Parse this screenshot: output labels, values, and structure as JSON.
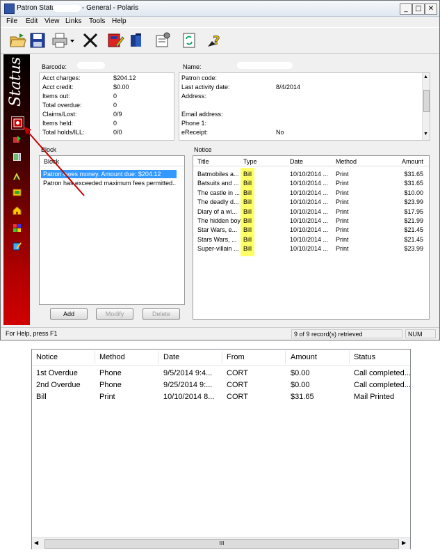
{
  "window": {
    "title_prefix": "Patron Status",
    "title_suffix": "- General - Polaris",
    "controls": [
      "_",
      "□",
      "✕"
    ]
  },
  "menu": [
    "File",
    "Edit",
    "View",
    "Links",
    "Tools",
    "Help"
  ],
  "toolbar_icons": [
    "open-folder-icon",
    "save-icon",
    "print-icon",
    "print-dropdown-icon",
    "delete-icon",
    "edit-record-icon",
    "books-icon",
    "properties-icon",
    "refresh-icon",
    "help-icon"
  ],
  "sidebar": {
    "label": "Status",
    "icons": [
      "status-icon",
      "check-in-icon",
      "barcode-items-icon",
      "claims-icon",
      "holds-icon",
      "home-icon",
      "fines-icon",
      "notes-icon"
    ]
  },
  "patron": {
    "barcode_label": "Barcode:",
    "name_label": "Name:",
    "left_rows": [
      {
        "label": "Acct charges:",
        "value": "$204.12"
      },
      {
        "label": "Acct credit:",
        "value": "$0.00"
      },
      {
        "label": "Items out:",
        "value": "0"
      },
      {
        "label": "Total overdue:",
        "value": "0"
      },
      {
        "label": "Claims/Lost:",
        "value": "0/9"
      },
      {
        "label": "Items held:",
        "value": "0"
      },
      {
        "label": "Total holds/ILL:",
        "value": "0/0"
      }
    ],
    "right_rows": [
      {
        "label": "Patron code:",
        "value": ""
      },
      {
        "label": "Last activity date:",
        "value": "8/4/2014"
      },
      {
        "label": "Address:",
        "value": ""
      },
      {
        "label": "",
        "value": "_"
      },
      {
        "label": "Email address:",
        "value": ""
      },
      {
        "label": "Phone 1:",
        "value": ""
      },
      {
        "label": "eReceipt:",
        "value": "No"
      }
    ]
  },
  "block": {
    "title": "Block",
    "header": "Block",
    "items": [
      "Patron owes money. Amount due: $204.12",
      "Patron has exceeded maximum fees permitted..."
    ],
    "buttons": {
      "add": "Add",
      "modify": "Modify",
      "delete": "Delete"
    }
  },
  "notice": {
    "title": "Notice",
    "columns": [
      "Title",
      "Type",
      "Date",
      "Method",
      "Amount"
    ],
    "rows": [
      {
        "title": "Batmobiles a...",
        "type": "Bill",
        "date": "10/10/2014 ...",
        "method": "Print",
        "amount": "$31.65"
      },
      {
        "title": "Batsuits and ...",
        "type": "Bill",
        "date": "10/10/2014 ...",
        "method": "Print",
        "amount": "$31.65"
      },
      {
        "title": "The castle in ...",
        "type": "Bill",
        "date": "10/10/2014 ...",
        "method": "Print",
        "amount": "$10.00"
      },
      {
        "title": "The deadly d...",
        "type": "Bill",
        "date": "10/10/2014 ...",
        "method": "Print",
        "amount": "$23.99"
      },
      {
        "title": "Diary of a wi...",
        "type": "Bill",
        "date": "10/10/2014 ...",
        "method": "Print",
        "amount": "$17.95"
      },
      {
        "title": "The hidden boy",
        "type": "Bill",
        "date": "10/10/2014 ...",
        "method": "Print",
        "amount": "$21.99"
      },
      {
        "title": "Star Wars, e...",
        "type": "Bill",
        "date": "10/10/2014 ...",
        "method": "Print",
        "amount": "$21.45"
      },
      {
        "title": "Stars Wars, ...",
        "type": "Bill",
        "date": "10/10/2014 ...",
        "method": "Print",
        "amount": "$21.45"
      },
      {
        "title": "Super-villain ...",
        "type": "Bill",
        "date": "10/10/2014 ...",
        "method": "Print",
        "amount": "$23.99"
      }
    ]
  },
  "statusbar": {
    "help": "For Help, press F1",
    "records": "9 of 9 record(s) retrieved",
    "num": "NUM"
  },
  "detail_list": {
    "columns": [
      "Notice",
      "Method",
      "Date",
      "From",
      "Amount",
      "Status"
    ],
    "rows": [
      {
        "notice": "1st Overdue",
        "method": "Phone",
        "date": "9/5/2014 9:4...",
        "from": "CORT",
        "amount": "$0.00",
        "status": "Call completed..."
      },
      {
        "notice": "2nd Overdue",
        "method": "Phone",
        "date": "9/25/2014 9:...",
        "from": "CORT",
        "amount": "$0.00",
        "status": "Call completed..."
      },
      {
        "notice": "Bill",
        "method": "Print",
        "date": "10/10/2014 8...",
        "from": "CORT",
        "amount": "$31.65",
        "status": "Mail Printed"
      }
    ],
    "scroll_grip": "III"
  },
  "colors": {
    "accent_red": "#c00000",
    "highlight_bill": "#ffff66",
    "selection": "#3399ff"
  }
}
